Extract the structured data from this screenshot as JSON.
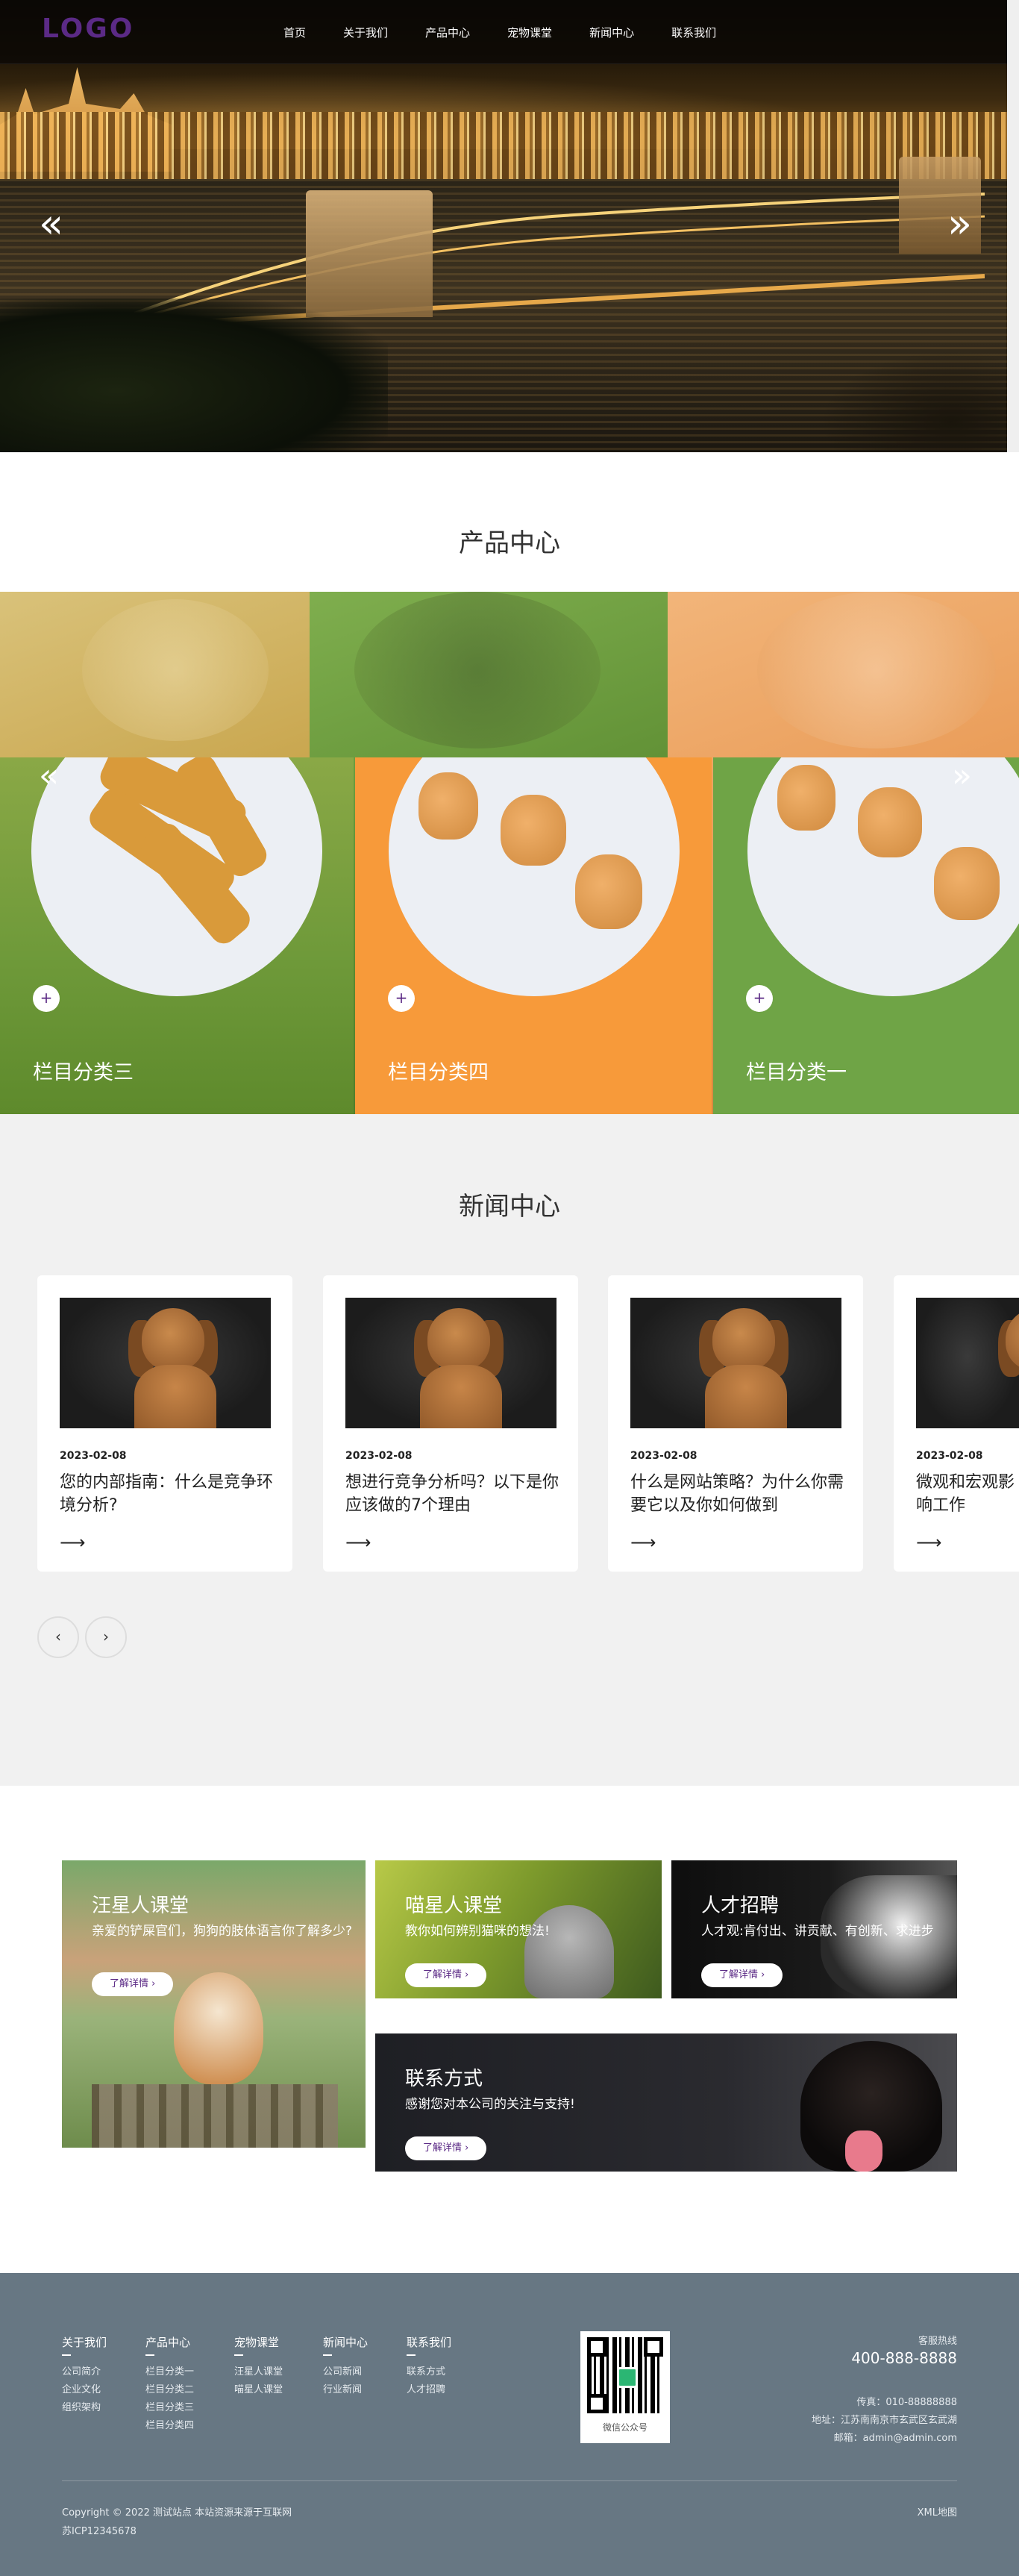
{
  "header": {
    "logo": "LOGO",
    "nav": [
      "首页",
      "关于我们",
      "产品中心",
      "宠物课堂",
      "新闻中心",
      "联系我们"
    ],
    "arrow_prev": "«",
    "arrow_next": "»"
  },
  "products": {
    "title": "产品中心",
    "arrow_prev": "«",
    "arrow_next": "»",
    "plus": "+",
    "items": [
      {
        "label": "栏目分类三"
      },
      {
        "label": "栏目分类四"
      },
      {
        "label": "栏目分类一"
      }
    ]
  },
  "news": {
    "title": "新闻中心",
    "arrow": "⟶",
    "prev": "‹",
    "next": "›",
    "items": [
      {
        "date": "2023-02-08",
        "title": "您的内部指南：什么是竞争环境分析?"
      },
      {
        "date": "2023-02-08",
        "title": "想进行竞争分析吗？以下是你应该做的7个理由"
      },
      {
        "date": "2023-02-08",
        "title": "什么是网站策略？为什么你需要它以及你如何做到"
      },
      {
        "date": "2023-02-08",
        "title": "微观和宏观影响工作"
      }
    ]
  },
  "promos": {
    "wang": {
      "title": "汪星人课堂",
      "desc": "亲爱的铲屎官们，狗狗的肢体语言你了解多少?",
      "btn": "了解详情 ›"
    },
    "miao": {
      "title": "喵星人课堂",
      "desc": "教你如何辨别猫咪的想法!",
      "btn": "了解详情 ›"
    },
    "job": {
      "title": "人才招聘",
      "desc": "人才观:肯付出、讲贡献、有创新、求进步",
      "btn": "了解详情 ›"
    },
    "contact": {
      "title": "联系方式",
      "desc": "感谢您对本公司的关注与支持!",
      "btn": "了解详情 ›"
    }
  },
  "footer": {
    "cols": [
      {
        "title": "关于我们",
        "items": [
          "公司简介",
          "企业文化",
          "组织架构"
        ]
      },
      {
        "title": "产品中心",
        "items": [
          "栏目分类一",
          "栏目分类二",
          "栏目分类三",
          "栏目分类四"
        ]
      },
      {
        "title": "宠物课堂",
        "items": [
          "汪星人课堂",
          "喵星人课堂"
        ]
      },
      {
        "title": "新闻中心",
        "items": [
          "公司新闻",
          "行业新闻"
        ]
      },
      {
        "title": "联系我们",
        "items": [
          "联系方式",
          "人才招聘"
        ]
      }
    ],
    "qr_caption": "微信公众号",
    "hotline_label": "客服热线",
    "hotline": "400-888-8888",
    "fax": "传真：010-88888888",
    "address": "地址：江苏南南京市玄武区玄武湖",
    "email": "邮箱：admin@admin.com",
    "copyright": "Copyright © 2022 测试站点 本站资源来源于互联网",
    "icp": "苏ICP12345678",
    "sitemap": "XML地图"
  },
  "colors": {
    "brand": "#5b2a86",
    "footer_bg": "#677783",
    "news_bg": "#f1f1f1"
  }
}
